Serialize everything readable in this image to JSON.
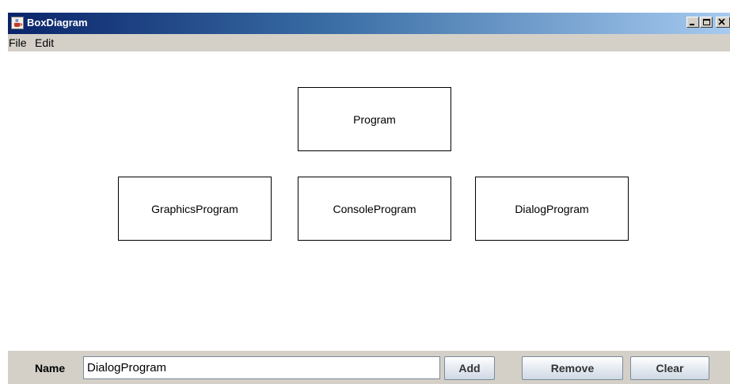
{
  "window": {
    "title": "BoxDiagram"
  },
  "menu": {
    "items": [
      "File",
      "Edit"
    ]
  },
  "diagram": {
    "boxes": [
      "Program",
      "GraphicsProgram",
      "ConsoleProgram",
      "DialogProgram"
    ]
  },
  "controls": {
    "name_label": "Name",
    "name_value": "DialogProgram",
    "add_label": "Add",
    "remove_label": "Remove",
    "clear_label": "Clear"
  },
  "colors": {
    "titlebar_start": "#0a246a",
    "titlebar_end": "#a6caf0",
    "chrome": "#d4d0c8",
    "canvas": "#ffffff"
  },
  "icons": {
    "app": "java-coffee-cup-icon",
    "minimize": "minimize-icon",
    "maximize": "maximize-icon",
    "close": "close-icon"
  }
}
